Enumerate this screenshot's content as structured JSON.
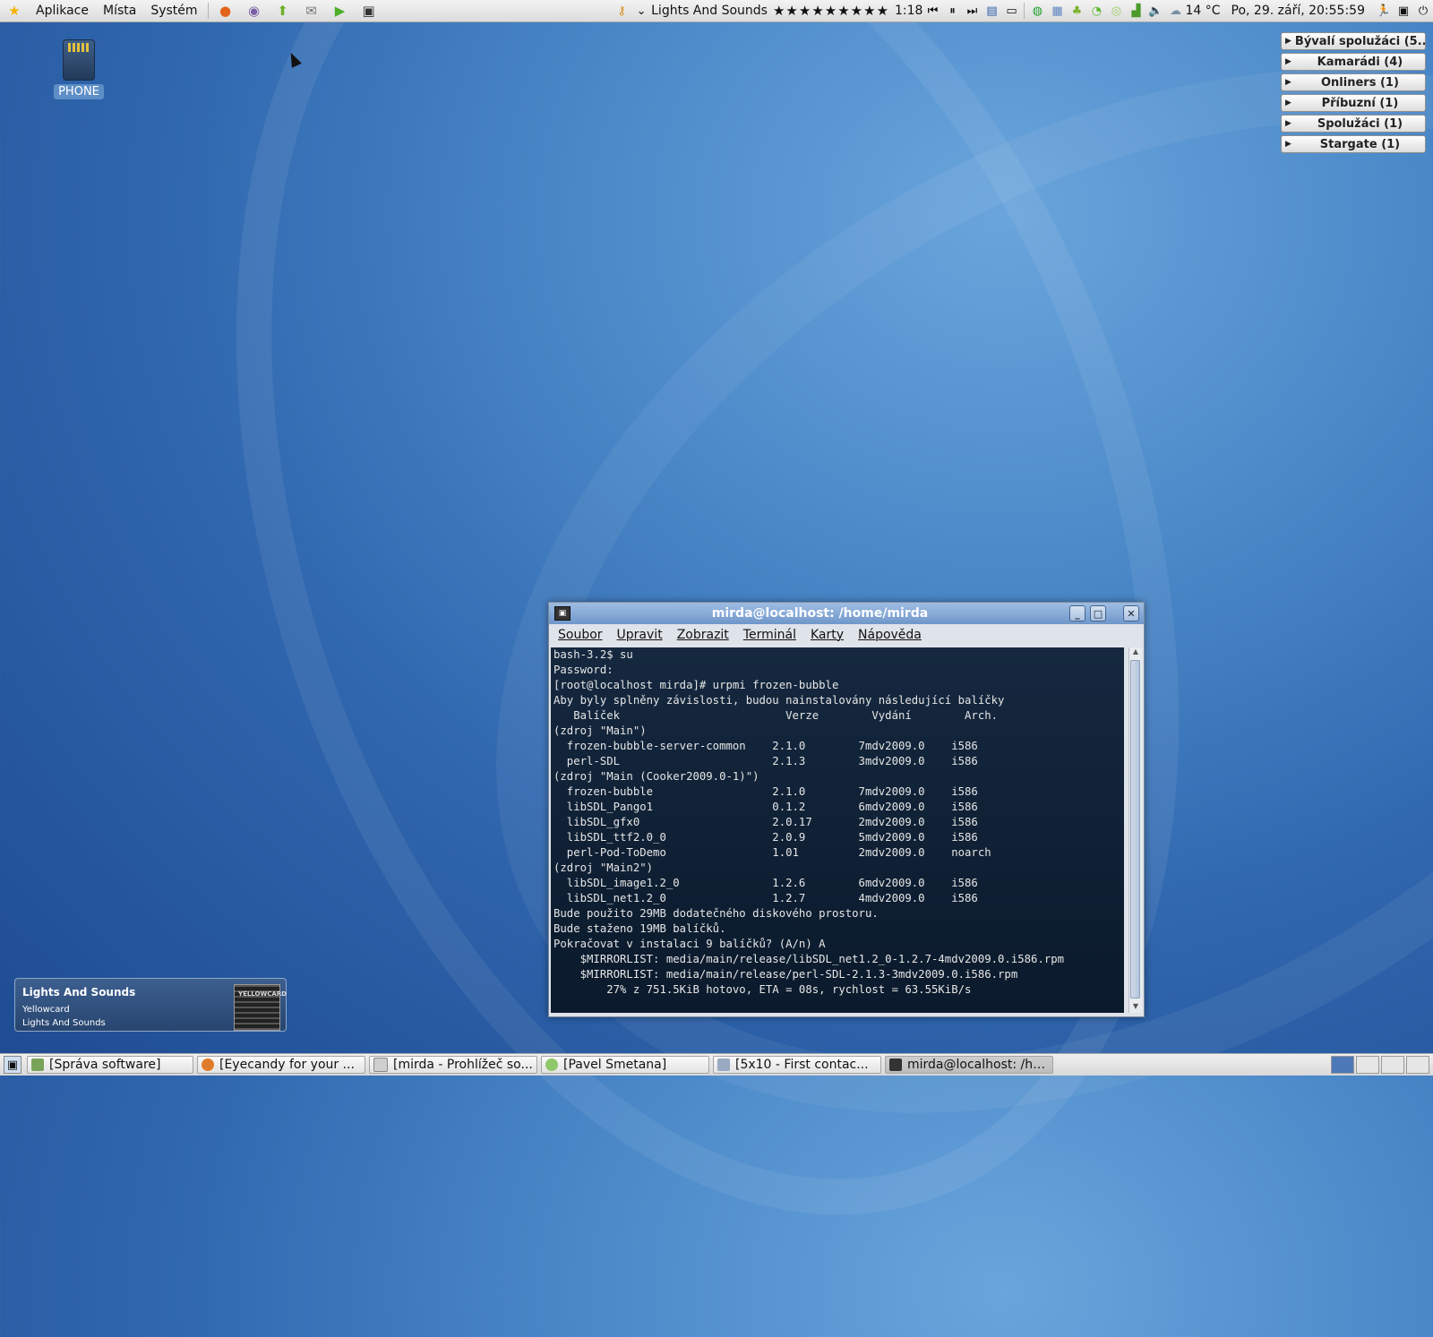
{
  "top_panel": {
    "menus": [
      "Aplikace",
      "Místa",
      "Systém"
    ],
    "launchers": [
      "firefox-icon",
      "pidgin-icon",
      "update-icon",
      "mail-icon",
      "media-play-icon",
      "terminal-icon"
    ],
    "player": {
      "song": "Lights And Sounds",
      "rating_stars": "★★★★★★★★★",
      "time": "1:18"
    },
    "weather": "14 °C",
    "clock": "Po, 29. září, 20:55:59"
  },
  "desktop": {
    "icon_label": "PHONE"
  },
  "groups": [
    {
      "label": "Bývalí spolužáci (5..."
    },
    {
      "label": "Kamarádi (4)"
    },
    {
      "label": "Onliners (1)"
    },
    {
      "label": "Příbuzní (1)"
    },
    {
      "label": "Spolužáci (1)"
    },
    {
      "label": "Stargate (1)"
    }
  ],
  "terminal": {
    "title": "mirda@localhost: /home/mirda",
    "menu": [
      "Soubor",
      "Upravit",
      "Zobrazit",
      "Terminál",
      "Karty",
      "Nápověda"
    ],
    "lines": [
      "bash-3.2$ su",
      "Password:",
      "[root@localhost mirda]# urpmi frozen-bubble",
      "Aby byly splněny závislosti, budou nainstalovány následující balíčky",
      "   Balíček                         Verze        Vydání        Arch.",
      "(zdroj \"Main\")",
      "  frozen-bubble-server-common    2.1.0        7mdv2009.0    i586",
      "  perl-SDL                       2.1.3        3mdv2009.0    i586",
      "(zdroj \"Main (Cooker2009.0-1)\")",
      "  frozen-bubble                  2.1.0        7mdv2009.0    i586",
      "  libSDL_Pango1                  0.1.2        6mdv2009.0    i586",
      "  libSDL_gfx0                    2.0.17       2mdv2009.0    i586",
      "  libSDL_ttf2.0_0                2.0.9        5mdv2009.0    i586",
      "  perl-Pod-ToDemo                1.01         2mdv2009.0    noarch",
      "(zdroj \"Main2\")",
      "  libSDL_image1.2_0              1.2.6        6mdv2009.0    i586",
      "  libSDL_net1.2_0                1.2.7        4mdv2009.0    i586",
      "Bude použito 29MB dodatečného diskového prostoru.",
      "Bude staženo 19MB balíčků.",
      "Pokračovat v instalaci 9 balíčků? (A/n) A",
      "",
      "    $MIRRORLIST: media/main/release/libSDL_net1.2_0-1.2.7-4mdv2009.0.i586.rpm",
      "    $MIRRORLIST: media/main/release/perl-SDL-2.1.3-3mdv2009.0.i586.rpm",
      "        27% z 751.5KiB hotovo, ETA = 08s, rychlost = 63.55KiB/s"
    ]
  },
  "notification": {
    "title": "Lights And Sounds",
    "artist": "Yellowcard",
    "album": "Lights And Sounds",
    "cover_text": "YELLOWCARD"
  },
  "taskbar": [
    {
      "label": "[Správa software]",
      "icon_color": "#7aa35a",
      "active": false
    },
    {
      "label": "[Eyecandy for your ...",
      "icon_color": "#e07b2a",
      "active": false
    },
    {
      "label": "[mirda - Prohlížeč so...",
      "icon_color": "#cfcfcf",
      "active": false
    },
    {
      "label": "[Pavel Smetana]",
      "icon_color": "#8ec86a",
      "active": false
    },
    {
      "label": "[5x10 - First contac...",
      "icon_color": "#9aa9c2",
      "active": false
    },
    {
      "label": "mirda@localhost: /ho...",
      "icon_color": "#333333",
      "active": true
    }
  ]
}
